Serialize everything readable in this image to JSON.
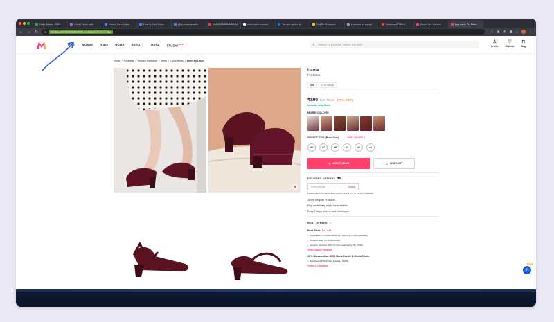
{
  "browser": {
    "tabs": [
      {
        "label": "Daily Status - 2023",
        "color": "#34a853"
      },
      {
        "label": "Chat | Vinod Jalla",
        "color": "#9b6bd3"
      },
      {
        "label": "How to Earn Coins",
        "color": "#4285f4"
      },
      {
        "label": "How to Earn Coins",
        "color": "#4285f4"
      },
      {
        "label": "(30) soeya anarthi",
        "color": "#4285f4"
      },
      {
        "label": "MMMMMMMMMMMM",
        "color": "#ea4335"
      },
      {
        "label": "what myntra brand",
        "color": "#ffffff"
      },
      {
        "label": "You are signed in",
        "color": "#1a73e8"
      },
      {
        "label": "DotiOh: Coupons",
        "color": "#fbbc05"
      },
      {
        "label": "A woman in a purp",
        "color": "#9aa0a6"
      },
      {
        "label": "Download PNG &",
        "color": "#ea4335"
      },
      {
        "label": "Shoes For Women",
        "color": "#ff3f6c"
      },
      {
        "label": "Buy Lavie PU Block",
        "color": "#ff3f6c"
      }
    ],
    "url": "myntra.com/heels/lavie/lavie-pu-block/23749077/buy"
  },
  "header": {
    "nav": [
      "MEN",
      "WOMEN",
      "KIDS",
      "HOME",
      "BEAUTY",
      "GENZ",
      "STUDIO"
    ],
    "studio_badge": "NEW",
    "search_placeholder": "Search for products, brands and more",
    "profile": "Profile",
    "wishlist": "Wishlist",
    "bag": "Bag"
  },
  "breadcrumb": {
    "home": "Home",
    "footwear": "Footwear",
    "women_footwear": "Women Footwear",
    "heels": "Heels",
    "lavie_heels": "Lavie Heels",
    "current": "More By Lavie",
    "sep": "/"
  },
  "product": {
    "brand": "Lavie",
    "name": "PU Block",
    "rating": "3.9",
    "star": "★",
    "ratings_count": "659 Ratings",
    "price": "₹899",
    "mrp_label": "MRP",
    "mrp": "₹2999",
    "discount": "(70% OFF)",
    "tax_note": "inclusive of all taxes",
    "more_colors": "MORE COLORS",
    "color_swatches": [
      "#e7ddd3",
      "#caa286",
      "#7a5032",
      "#c9a88e",
      "#7d3a2c",
      "#c48e72"
    ],
    "select_size": "SELECT SIZE (Euro Size)",
    "size_chart": "SIZE CHART >",
    "sizes": [
      "36",
      "37",
      "38",
      "39",
      "40",
      "41"
    ],
    "add_to_bag": "ADD TO BAG",
    "wishlist": "WISHLIST",
    "delivery_options": "DELIVERY OPTIONS",
    "pincode_placeholder": "Enter pincode",
    "check": "Check",
    "pincode_note": "Please enter PIN code to check delivery time & Pay on Delivery Availability",
    "policies": [
      "100% Original Products",
      "Pay on delivery might be available",
      "Easy 7 days returns and exchanges"
    ],
    "best_offers": "BEST OFFERS",
    "best_price_label": "Best Price:",
    "best_price": "Rs. 349",
    "offer_points": [
      "Applicable on: Orders above Rs. 199 (only on first purchase)",
      "Coupon code: MYNTRAWOW2",
      "Coupon Discount: 60% off (Your total saving: Rs. 2450)"
    ],
    "view_eligible": "View Eligible Products",
    "bank_offer": "10% Discount on ICICI Bank Credit & Debit Cards.",
    "bank_points": [
      "Min Spend ₹3500, Max Discount ₹1000."
    ],
    "terms": "Terms & Condition"
  },
  "widget": {
    "badge": "NEW"
  }
}
